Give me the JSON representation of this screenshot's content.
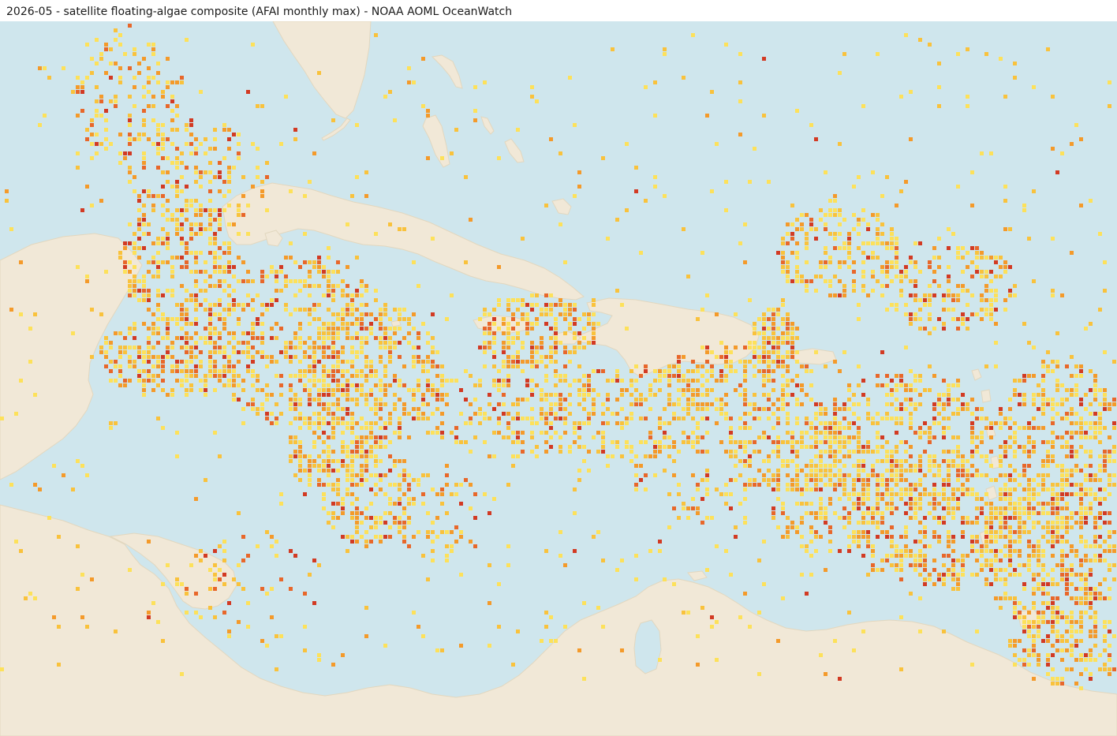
{
  "title": "2026-05 - satellite floating-algae composite (AFAI monthly max) - NOAA AOML OceanWatch",
  "map": {
    "ocean_color": "#cfe6ed",
    "land_color": "#f1e8d7",
    "coast_color": "#e6dcc6",
    "algae_colors": [
      "#fde15a",
      "#f9c23c",
      "#f49a2a",
      "#e8672a",
      "#d23a23"
    ]
  }
}
